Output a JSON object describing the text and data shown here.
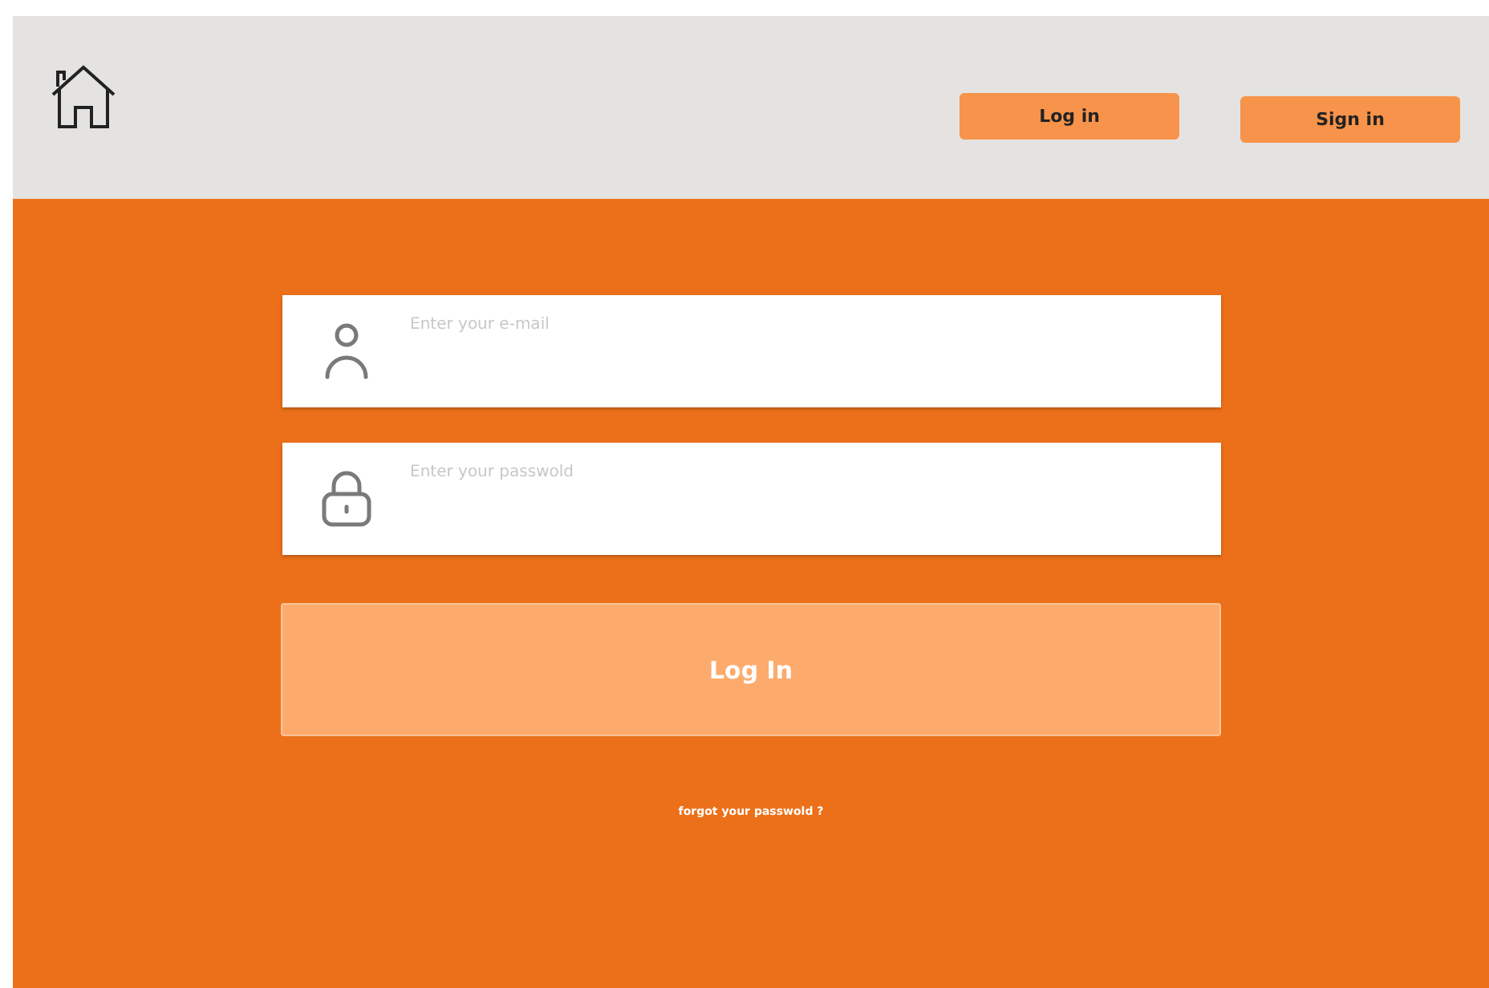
{
  "header": {
    "buttons": [
      {
        "label": "Log in"
      },
      {
        "label": "Sign in"
      }
    ]
  },
  "form": {
    "fields": [
      {
        "kind": "email",
        "placeholder": "Enter your e-mail"
      },
      {
        "kind": "password",
        "placeholder": "Enter your passwold"
      }
    ],
    "submit": "Log In",
    "forgot_link": "forgot your passwold ?"
  }
}
